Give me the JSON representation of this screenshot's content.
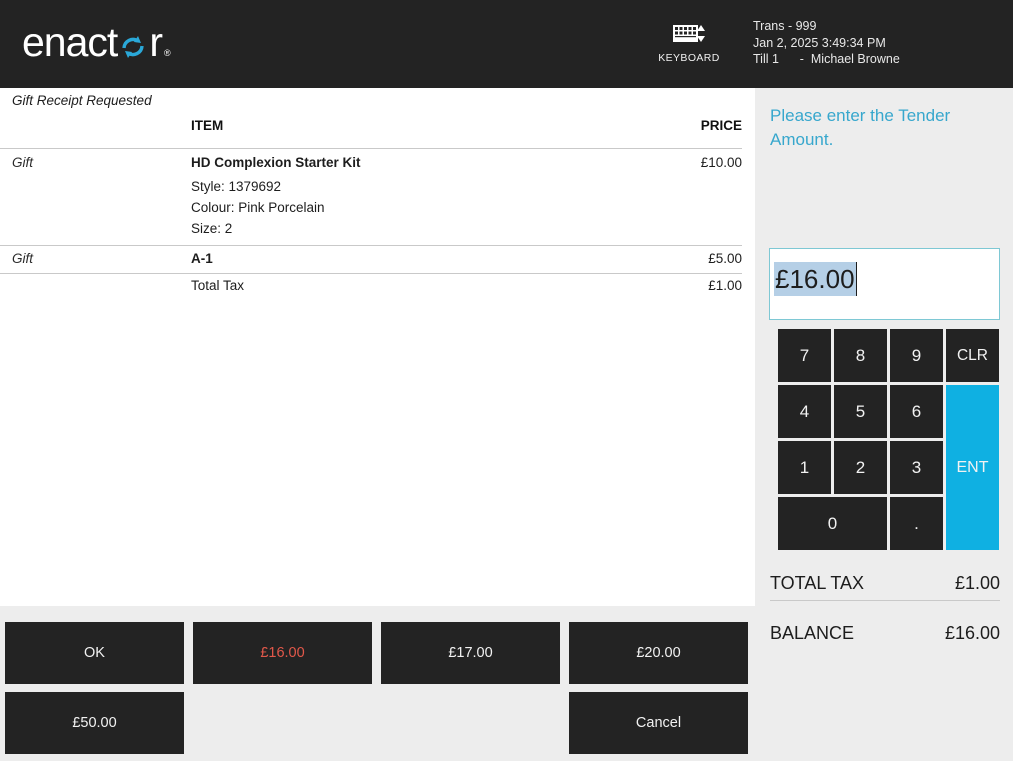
{
  "header": {
    "logo_pre": "enact",
    "logo_post": "r",
    "logo_tm": "®",
    "keyboard_label": "KEYBOARD",
    "keyboard_icon": "keyboard-icon",
    "trans_line1": "Trans - 999",
    "trans_line2": "Jan 2, 2025 3:49:34 PM",
    "trans_line3": "Till 1      -  Michael Browne",
    "bg_color": "#232323"
  },
  "receipt": {
    "gift_note": "Gift Receipt Requested",
    "columns": {
      "gift": "",
      "item": "ITEM",
      "price": "PRICE"
    },
    "lines": [
      {
        "gift": "Gift",
        "item": "HD Complexion Starter Kit",
        "price": "£10.00",
        "details": [
          "Style: 1379692",
          "Colour: Pink Porcelain",
          "Size: 2"
        ]
      },
      {
        "gift": "Gift",
        "item": "A-1",
        "price": "£5.00",
        "details": []
      }
    ],
    "tax_row": {
      "label": "Total Tax",
      "value": "£1.00"
    }
  },
  "tender": {
    "prompt": "Please enter the Tender Amount.",
    "amount_value": "£16.00",
    "prompt_color": "#37a7cd",
    "selection_color": "#b5cfe6",
    "keypad": [
      {
        "label": "7",
        "name": "key-7",
        "style": "dark"
      },
      {
        "label": "8",
        "name": "key-8",
        "style": "dark"
      },
      {
        "label": "9",
        "name": "key-9",
        "style": "dark"
      },
      {
        "label": "CLR",
        "name": "key-clear",
        "style": "dark"
      },
      {
        "label": "4",
        "name": "key-4",
        "style": "dark"
      },
      {
        "label": "5",
        "name": "key-5",
        "style": "dark"
      },
      {
        "label": "6",
        "name": "key-6",
        "style": "dark"
      },
      {
        "label": "1",
        "name": "key-1",
        "style": "dark"
      },
      {
        "label": "2",
        "name": "key-2",
        "style": "dark"
      },
      {
        "label": "3",
        "name": "key-3",
        "style": "dark"
      },
      {
        "label": "0",
        "name": "key-0",
        "style": "dark"
      },
      {
        "label": ".",
        "name": "key-decimal",
        "style": "dark"
      },
      {
        "label": "ENT",
        "name": "key-enter",
        "style": "accent"
      }
    ],
    "enter_color": "#0fb0e2",
    "totals": [
      {
        "label": "TOTAL TAX",
        "value": "£1.00"
      },
      {
        "label": "BALANCE",
        "value": "£16.00"
      }
    ]
  },
  "bottom_bar": {
    "buttons": [
      {
        "label": "OK",
        "name": "ok-button",
        "accent": false
      },
      {
        "label": "£16.00",
        "name": "tender-16-button",
        "accent": true
      },
      {
        "label": "£17.00",
        "name": "tender-17-button",
        "accent": false
      },
      {
        "label": "£20.00",
        "name": "tender-20-button",
        "accent": false
      },
      {
        "label": "£50.00",
        "name": "tender-50-button",
        "accent": false
      },
      {
        "label": "",
        "name": "empty-slot",
        "accent": false
      },
      {
        "label": "",
        "name": "empty-slot",
        "accent": false
      },
      {
        "label": "Cancel",
        "name": "cancel-button",
        "accent": false
      }
    ],
    "accent_color": "#e2584a"
  }
}
